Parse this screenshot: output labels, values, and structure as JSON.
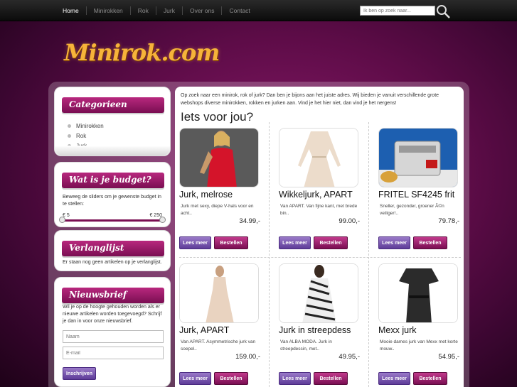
{
  "nav": {
    "items": [
      "Home",
      "Minirokken",
      "Rok",
      "Jurk",
      "Over ons",
      "Contact"
    ],
    "search_placeholder": "Ik ben op zoek naar..."
  },
  "logo": "Minirok.com",
  "sidebar": {
    "categories": {
      "title": "Categorieen",
      "items": [
        "Minirokken",
        "Rok",
        "Jurk"
      ]
    },
    "budget": {
      "title": "Wat is je budget?",
      "text": "Beweeg de sliders om je gewenste budget in te stellen:",
      "min": "€ 5",
      "max": "€ 250"
    },
    "wishlist": {
      "title": "Verlanglijst",
      "text": "Er staan nog geen artikelen op je verlanglijst."
    },
    "newsletter": {
      "title": "Nieuwsbrief",
      "text": "Wil je op de hoogte gehouden worden als er nieuwe artikelen worden toegevoegd? Schrijf je dan in voor onze nieuwsbrief.",
      "name_placeholder": "Naam",
      "email_placeholder": "E-mail",
      "button": "Inschrijven"
    }
  },
  "main": {
    "intro": "Op zoek naar een minirok, rok of jurk? Dan ben je bijons aan het juiste adres. Wij bieden je vanuit verschillende grote webshops diverse minirokken, rokken en jurken aan. Vind je het hier niet, dan vind je het nergens!",
    "title": "Iets voor jou?",
    "more_label": "Lees meer",
    "order_label": "Bestellen",
    "products": [
      {
        "title": "Jurk, melrose",
        "desc": "Jurk met sexy, diepe V-hals voor en acht..",
        "price": "34.99,-"
      },
      {
        "title": "Wikkeljurk, APART",
        "desc": "Van APART. Van fijne kant, met brede bin..",
        "price": "99.00,-"
      },
      {
        "title": "FRITEL SF4245 frit",
        "desc": "Sneller, gezonder, groener Ã©n veiliger!..",
        "price": "79.78,-"
      },
      {
        "title": "Jurk, APART",
        "desc": "Van APART. Asymmetrische jurk van soepel..",
        "price": "159.00,-"
      },
      {
        "title": "Jurk in streepdess",
        "desc": "Van ALBA MODA. Jurk in streepdessin, met..",
        "price": "49.95,-"
      },
      {
        "title": "Mexx jurk",
        "desc": "Mooie dames jurk van Mexx met korte mouw..",
        "price": "54.95,-"
      }
    ]
  }
}
